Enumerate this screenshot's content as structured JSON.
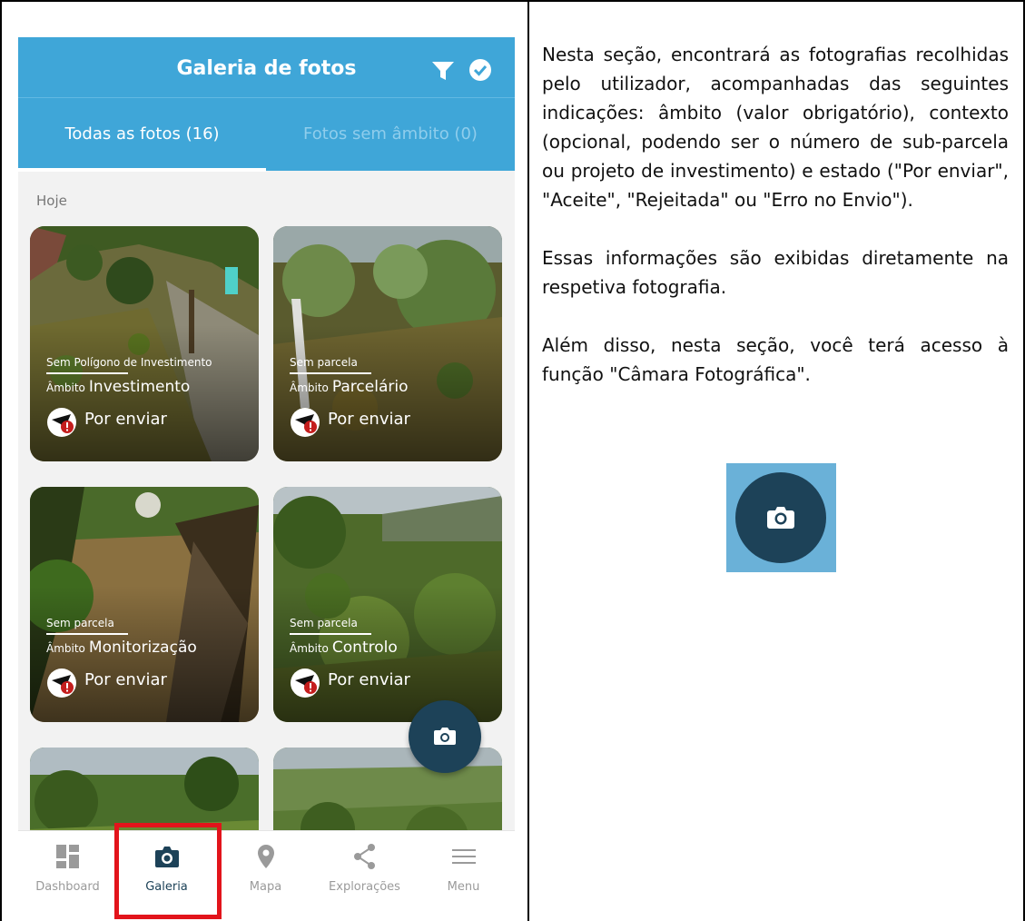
{
  "app": {
    "title": "Galeria de fotos",
    "tabs": [
      {
        "label": "Todas as fotos (16)",
        "active": true
      },
      {
        "label": "Fotos sem âmbito (0)",
        "active": false
      }
    ],
    "section_label": "Hoje",
    "photos": [
      {
        "parcel": "Sem Polígono de Investimento",
        "ambito_label": "Âmbito",
        "ambito": "Investimento",
        "status": "Por enviar"
      },
      {
        "parcel": "Sem parcela",
        "ambito_label": "Âmbito",
        "ambito": "Parcelário",
        "status": "Por enviar"
      },
      {
        "parcel": "Sem parcela",
        "ambito_label": "Âmbito",
        "ambito": "Monitorização",
        "status": "Por enviar"
      },
      {
        "parcel": "Sem parcela",
        "ambito_label": "Âmbito",
        "ambito": "Controlo",
        "status": "Por enviar"
      }
    ],
    "nav": [
      {
        "label": "Dashboard",
        "icon": "dashboard-icon",
        "active": false
      },
      {
        "label": "Galeria",
        "icon": "camera-icon",
        "active": true
      },
      {
        "label": "Mapa",
        "icon": "map-pin-icon",
        "active": false
      },
      {
        "label": "Explorações",
        "icon": "share-icon",
        "active": false
      },
      {
        "label": "Menu",
        "icon": "menu-icon",
        "active": false
      }
    ],
    "colors": {
      "primary": "#3fa6d8",
      "fab": "#1d4258",
      "highlight": "#e2141b",
      "status_icon": "#c41e1e"
    }
  },
  "description": {
    "paragraphs": [
      "Nesta seção, encontrará as fotografias recolhidas pelo utilizador, acompanhadas das seguintes indicações: âmbito (valor obrigatório), contexto (opcional, podendo ser o número de sub-parcela ou projeto de investimento) e estado (\"Por enviar\", \"Aceite\", \"Rejeitada\" ou \"Erro no Envio\").",
      "Essas informações são exibidas diretamente na respetiva fotografia.",
      "Além disso, nesta seção, você terá acesso à função \"Câmara Fotográfica\"."
    ]
  }
}
